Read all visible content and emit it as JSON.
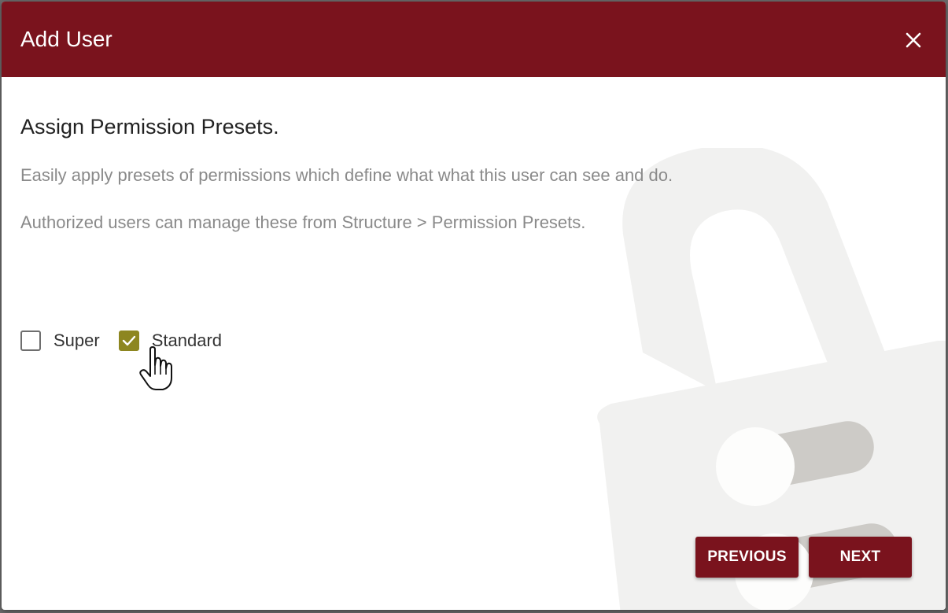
{
  "dialog": {
    "title": "Add User",
    "close_icon": "close-icon"
  },
  "content": {
    "heading": "Assign Permission Presets.",
    "description_1": "Easily apply presets of permissions which define what what this user can see and do.",
    "description_2": "Authorized users can manage these from Structure > Permission Presets."
  },
  "presets": [
    {
      "label": "Super",
      "checked": false
    },
    {
      "label": "Standard",
      "checked": true
    }
  ],
  "buttons": {
    "previous": "PREVIOUS",
    "next": "NEXT"
  },
  "colors": {
    "header": "#7a131d",
    "checkbox_checked": "#8d8620",
    "button": "#7a131d"
  },
  "icons": {
    "background": "lock-icon",
    "cursor": "hand-pointer-icon",
    "check": "checkmark-icon"
  }
}
